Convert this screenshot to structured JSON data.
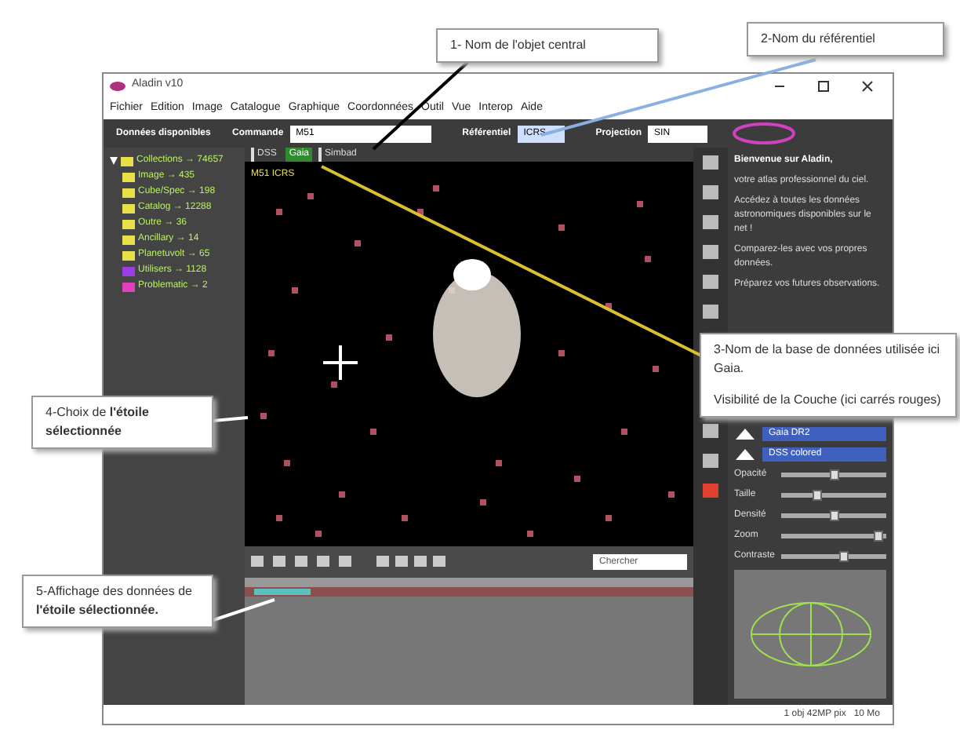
{
  "callouts": [
    {
      "kind": "plain",
      "text": "1- Nom de l'objet central"
    },
    {
      "kind": "plain",
      "text": "2-Nom du référentiel"
    },
    {
      "kind": "plain",
      "text": "4-Choix de **l'étoile sélectionnée**"
    },
    {
      "kind": "layer",
      "text": "3-Nom de la base de données utilisée ici Gaia.",
      "note": "Visibilité de la Couche (ici carrés rouges)"
    },
    {
      "kind": "plain",
      "text": "5-Affichage des données de **l'étoile sélectionnée.**"
    }
  ],
  "window": {
    "title": "Aladin v10"
  },
  "menu": [
    "Fichier",
    "Edition",
    "Image",
    "Catalogue",
    "Graphique",
    "Coordonnées",
    "Outil",
    "Vue",
    "Interop",
    "Aide"
  ],
  "toolbar": {
    "available_label": "Données disponibles",
    "command_label": "Commande",
    "command_value": "M51",
    "frame_label": "Référentiel",
    "frame_value": "ICRS",
    "projection_label": "Projection",
    "projection_value": "SIN"
  },
  "tree": {
    "label": "Collections → 74657",
    "expanded": true,
    "children": [
      {
        "label": "Image → 435",
        "color": "#e8e04a"
      },
      {
        "label": "Cube/Spec → 198",
        "color": "#e8e04a"
      },
      {
        "label": "Catalog → 12288",
        "color": "#e8e04a"
      },
      {
        "label": "Outre → 36",
        "color": "#e8e04a"
      },
      {
        "label": "Ancillary → 14",
        "color": "#e8e04a"
      },
      {
        "label": "Planetuvolt → 65",
        "color": "#e8e04a"
      },
      {
        "label": "Utilisers → 1128",
        "color": "#9a3fe0"
      },
      {
        "label": "Problematic → 2",
        "color": "#e040c0"
      }
    ]
  },
  "layer_tabs": [
    {
      "label": "DSS",
      "selected": false
    },
    {
      "label": "Gaia",
      "selected": true
    },
    {
      "label": "Simbad",
      "selected": false
    }
  ],
  "view": {
    "label": "M51 ICRS"
  },
  "search": {
    "placeholder": "Chercher"
  },
  "welcome": {
    "title": "Bienvenue sur Aladin,",
    "body": "votre atlas professionnel du ciel.",
    "bullets": [
      "Accédez à toutes les données astronomiques disponibles sur le net !",
      "Comparez-les avec vos propres données.",
      "Préparez vos futures observations."
    ]
  },
  "layers": [
    {
      "name": "Gaia DR2",
      "visible": true
    },
    {
      "name": "DSS colored",
      "visible": true
    }
  ],
  "sliders": [
    {
      "name": "Opacité",
      "level": 0.5
    },
    {
      "name": "Taille",
      "level": 0.35
    },
    {
      "name": "Densité",
      "level": 0.5
    },
    {
      "name": "Zoom",
      "level": 0.92
    },
    {
      "name": "Contraste",
      "level": 0.6
    }
  ],
  "status": "1 obj 42MP pix   10 Mo"
}
